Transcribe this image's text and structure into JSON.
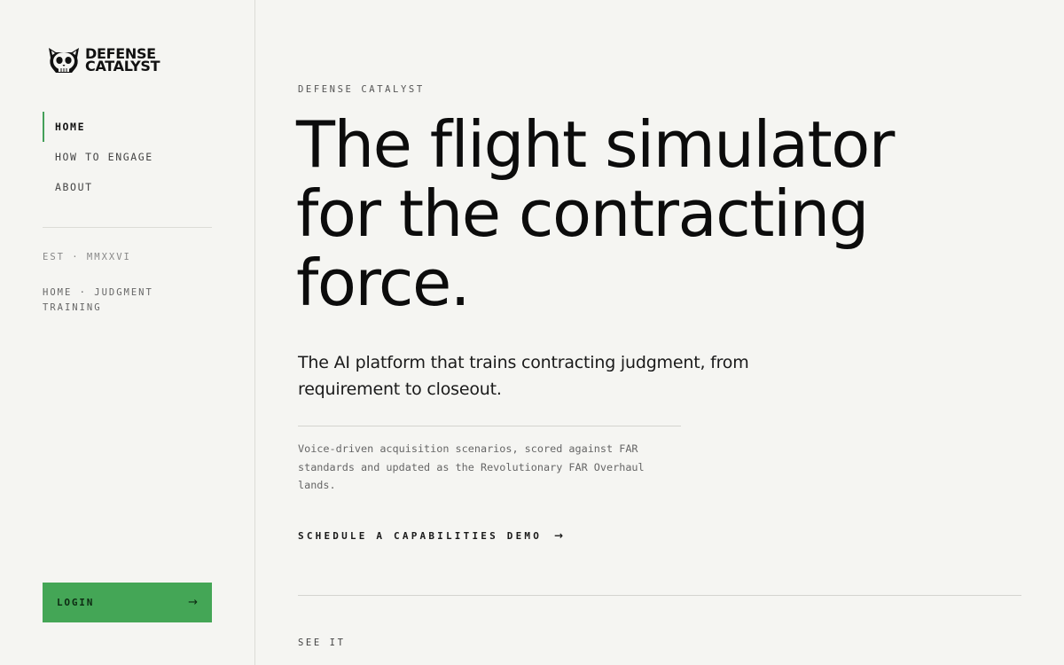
{
  "brand": {
    "logo_line1": "DEFENSE",
    "logo_line2": "CATALYST",
    "logo_icon": "cat-skull-icon"
  },
  "sidebar": {
    "nav": [
      {
        "label": "HOME",
        "active": true
      },
      {
        "label": "HOW TO ENGAGE",
        "active": false
      },
      {
        "label": "ABOUT",
        "active": false
      }
    ],
    "est": "EST · MMXXVI",
    "breadcrumb": "HOME · JUDGMENT TRAINING",
    "login_label": "LOGIN",
    "login_arrow": "→"
  },
  "hero": {
    "eyebrow": "DEFENSE CATALYST",
    "headline_lines": [
      "The flight simulator",
      "for the contracting",
      "force."
    ],
    "lede": "The AI platform that trains contracting judgment, from requirement to closeout.",
    "body": "Voice-driven acquisition scenarios, scored against FAR standards and updated as the Revolutionary FAR Overhaul lands.",
    "cta_label": "SCHEDULE A CAPABILITIES DEMO",
    "cta_arrow": "→",
    "next_section_label": "SEE IT"
  },
  "colors": {
    "background": "#f5f5f2",
    "accent": "#44a656",
    "text": "#111111",
    "divider": "#dcdcd7"
  }
}
